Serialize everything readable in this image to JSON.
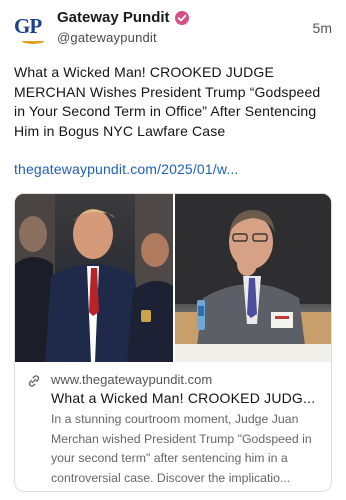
{
  "post": {
    "author": {
      "avatar_text": "GP",
      "display_name": "Gateway Pundit",
      "handle": "@gatewaypundit",
      "verified_icon": "verified-badge-icon",
      "badge_color": "#d44f86"
    },
    "timestamp": "5m",
    "text": "What a Wicked Man! CROOKED JUDGE MERCHAN Wishes President Trump “Godspeed in Your Second Term in Office” After Sentencing Him in Bogus NYC Lawfare Case",
    "link_text": "thegatewaypundit.com/2025/01/w...",
    "link_color": "#1f5fb8"
  },
  "card": {
    "domain_icon": "link-icon",
    "domain": "www.thegatewaypundit.com",
    "title": "What a Wicked Man! CROOKED JUDG...",
    "description": "In a stunning courtroom moment, Judge Juan Merchan wished President Trump \"Godspeed in your second term\" after sentencing him in a controversial case. Discover the implicatio..."
  }
}
